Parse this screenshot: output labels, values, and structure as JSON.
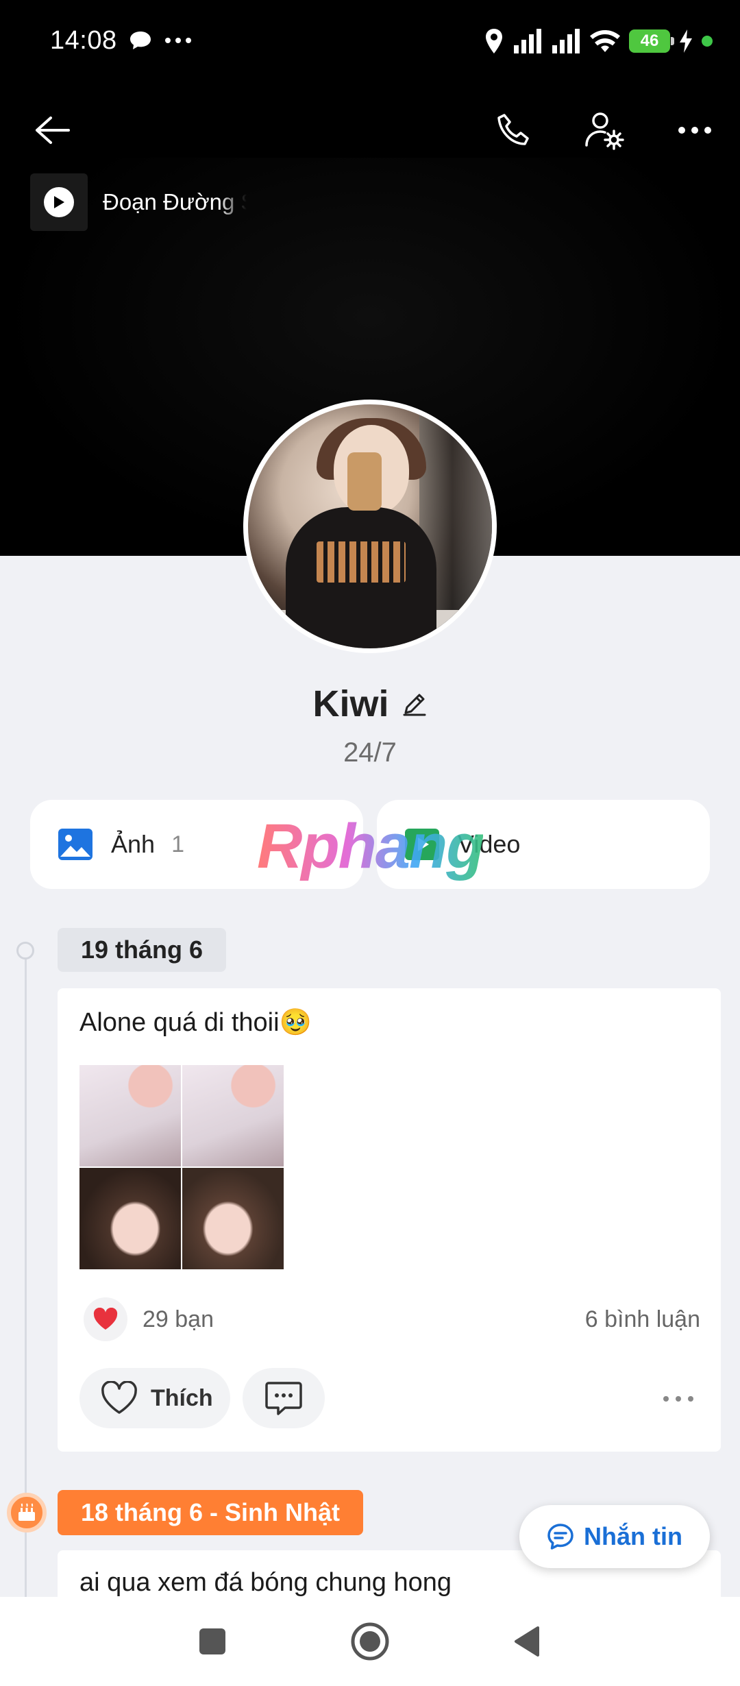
{
  "status_bar": {
    "time": "14:08",
    "battery": "46"
  },
  "music": {
    "title": "Đoạn Đường S"
  },
  "profile": {
    "name": "Kiwi",
    "status": "24/7"
  },
  "media": {
    "photos_label": "Ảnh",
    "photos_count": "1",
    "videos_label": "Video"
  },
  "watermark": "Rphang",
  "posts": [
    {
      "date": "19 tháng 6",
      "text": "Alone quá di thoii🥹",
      "likes": "29 bạn",
      "comments": "6 bình luận",
      "like_label": "Thích"
    },
    {
      "date": "18 tháng 6 - Sinh Nhật",
      "text": "ai qua xem đá bóng chung hong"
    }
  ],
  "message_button": "Nhắn tin",
  "colors": {
    "accent_blue": "#1a6fd6",
    "birthday_orange": "#ff7f33",
    "heart_red": "#e8323d"
  }
}
